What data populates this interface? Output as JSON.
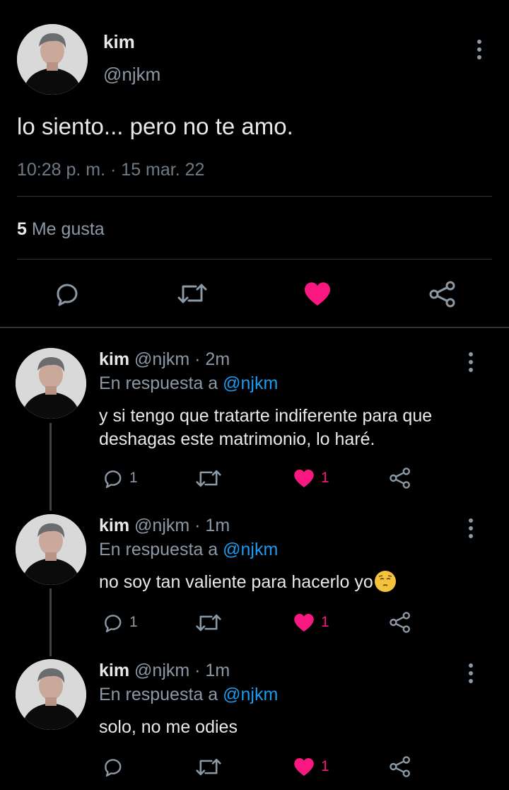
{
  "main_tweet": {
    "name": "kim",
    "handle": "@njkm",
    "text": "lo siento... pero no te amo.",
    "timestamp": "10:28 p. m. · 15 mar. 22",
    "likes_count": "5",
    "likes_label": "Me gusta",
    "icons": [
      "reply-icon",
      "retweet-icon",
      "heart-filled-icon",
      "share-icon"
    ]
  },
  "replies": [
    {
      "name": "kim",
      "meta": "@njkm · 2m",
      "reply_prefix": "En respuesta a",
      "reply_to": "@njkm",
      "text": "y si tengo que tratarte indiferente para que deshagas este matrimonio, lo haré.",
      "reply_count": "1",
      "like_count": "1"
    },
    {
      "name": "kim",
      "meta": "@njkm · 1m",
      "reply_prefix": "En respuesta a",
      "reply_to": "@njkm",
      "text": "no soy tan valiente para hacerlo yo",
      "emoji": "pensive-face-emoji",
      "reply_count": "1",
      "like_count": "1"
    },
    {
      "name": "kim",
      "meta": "@njkm · 1m",
      "reply_prefix": "En respuesta a",
      "reply_to": "@njkm",
      "text": "solo, no me odies",
      "like_count": "1"
    }
  ],
  "colors": {
    "background": "#000000",
    "text": "#e7e9ea",
    "secondary": "#8b98a5",
    "mention": "#1d9bf0",
    "like": "#f91880",
    "divider": "#2f3336"
  }
}
